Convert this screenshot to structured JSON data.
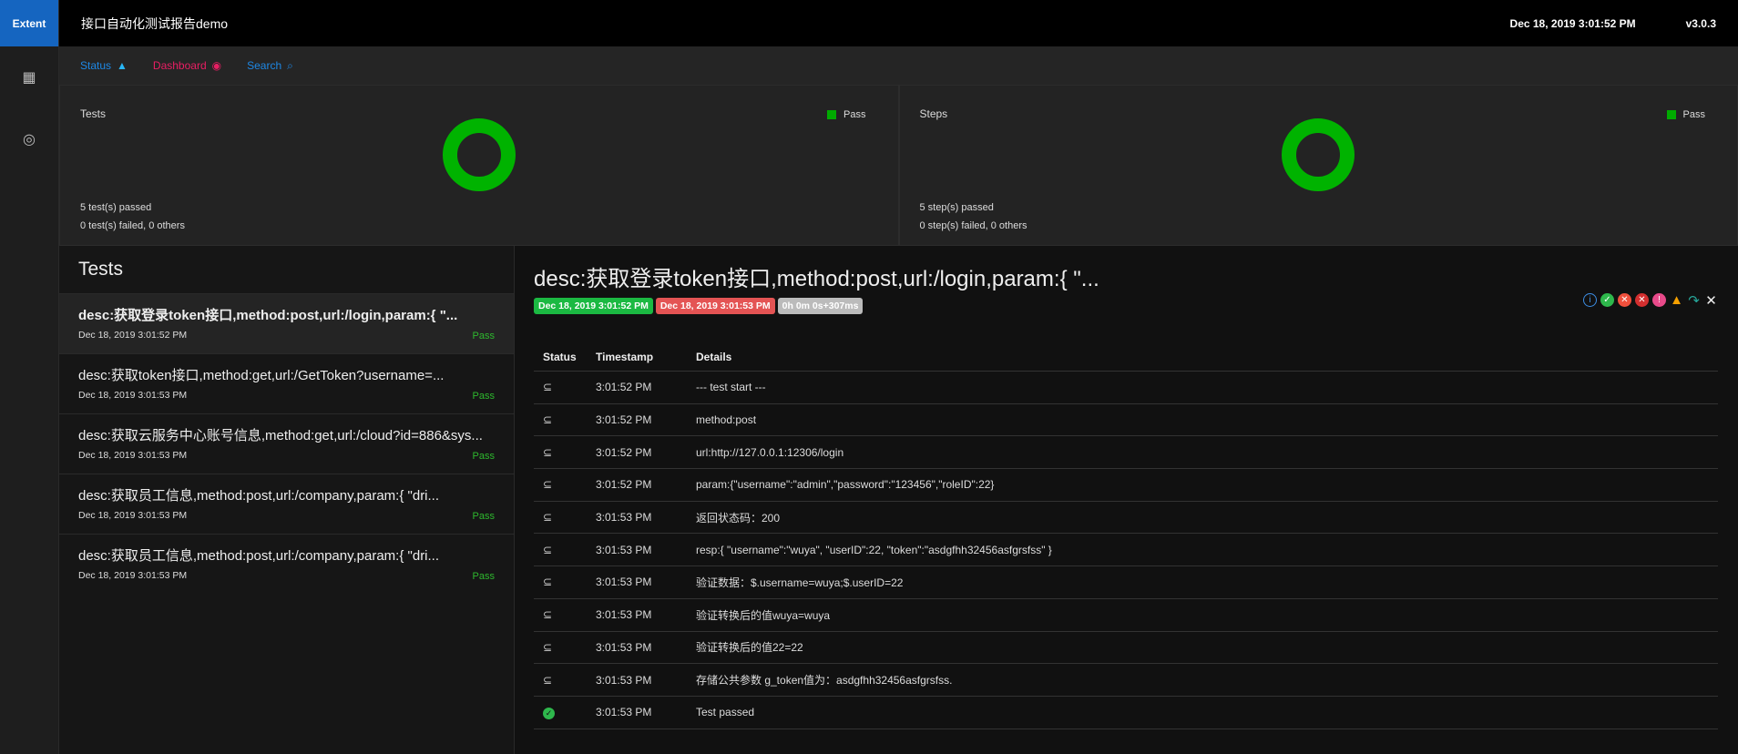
{
  "brand": "Extent",
  "header": {
    "title": "接口自动化测试报告demo",
    "date": "Dec 18, 2019 3:01:52 PM",
    "version": "v3.0.3"
  },
  "nav": {
    "status": "Status",
    "dashboard": "Dashboard",
    "search": "Search"
  },
  "dashboard": {
    "tests": {
      "title": "Tests",
      "legend": "Pass",
      "passed": "5 test(s) passed",
      "failed": "0 test(s) failed, 0 others",
      "pass_fraction": 1.0
    },
    "steps": {
      "title": "Steps",
      "legend": "Pass",
      "passed": "5 step(s) passed",
      "failed": "0 step(s) failed, 0 others",
      "pass_fraction": 1.0
    }
  },
  "list": {
    "title": "Tests",
    "items": [
      {
        "name": "desc:获取登录token接口,method:post,url:/login,param:{ \"...",
        "date": "Dec 18, 2019 3:01:52 PM",
        "status": "Pass"
      },
      {
        "name": "desc:获取token接口,method:get,url:/GetToken?username=...",
        "date": "Dec 18, 2019 3:01:53 PM",
        "status": "Pass"
      },
      {
        "name": "desc:获取云服务中心账号信息,method:get,url:/cloud?id=886&sys...",
        "date": "Dec 18, 2019 3:01:53 PM",
        "status": "Pass"
      },
      {
        "name": "desc:获取员工信息,method:post,url:/company,param:{ \"dri...",
        "date": "Dec 18, 2019 3:01:53 PM",
        "status": "Pass"
      },
      {
        "name": "desc:获取员工信息,method:post,url:/company,param:{ \"dri...",
        "date": "Dec 18, 2019 3:01:53 PM",
        "status": "Pass"
      }
    ]
  },
  "detail": {
    "title": "desc:获取登录token接口,method:post,url:/login,param:{ \"...",
    "start": "Dec 18, 2019 3:01:52 PM",
    "end": "Dec 18, 2019 3:01:53 PM",
    "duration": "0h 0m 0s+307ms",
    "columns": [
      "Status",
      "Timestamp",
      "Details"
    ],
    "rows": [
      {
        "status": "info",
        "time": "3:01:52 PM",
        "details": "--- test start ---"
      },
      {
        "status": "info",
        "time": "3:01:52 PM",
        "details": "method:post"
      },
      {
        "status": "info",
        "time": "3:01:52 PM",
        "details": "url:http://127.0.0.1:12306/login"
      },
      {
        "status": "info",
        "time": "3:01:52 PM",
        "details": "param:{\"username\":\"admin\",\"password\":\"123456\",\"roleID\":22}"
      },
      {
        "status": "info",
        "time": "3:01:53 PM",
        "details": "返回状态码：200"
      },
      {
        "status": "info",
        "time": "3:01:53 PM",
        "details": "resp:{ \"username\":\"wuya\", \"userID\":22, \"token\":\"asdgfhh32456asfgrsfss\" }"
      },
      {
        "status": "info",
        "time": "3:01:53 PM",
        "details": "验证数据：$.username=wuya;$.userID=22"
      },
      {
        "status": "info",
        "time": "3:01:53 PM",
        "details": "验证转换后的值wuya=wuya"
      },
      {
        "status": "info",
        "time": "3:01:53 PM",
        "details": "验证转换后的值22=22"
      },
      {
        "status": "info",
        "time": "3:01:53 PM",
        "details": "存储公共参数 g_token值为：asdgfhh32456asfgrsfss."
      },
      {
        "status": "pass",
        "time": "3:01:53 PM",
        "details": "Test passed"
      }
    ]
  },
  "colors": {
    "brand": "#1565c0",
    "pass": "#00b300",
    "fail": "#e53935",
    "status_nav": "#1e88e5",
    "dashboard_nav": "#e91e63"
  }
}
